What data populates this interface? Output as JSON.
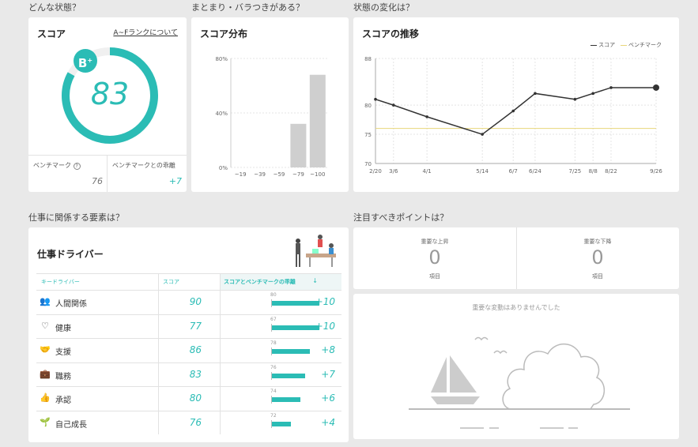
{
  "sections": {
    "state": "どんな状態？",
    "spread": "まとまり・バラつきがある？",
    "trend": "状態の変化は？",
    "factors": "仕事に関係する要素は？",
    "points": "注目すべきポイントは？"
  },
  "score_card": {
    "title": "スコア",
    "rank_link": "A~Fランクについて",
    "grade": "B",
    "grade_sup": "+",
    "score": "83",
    "score_fraction": 0.83,
    "benchmark_label": "ベンチマーク",
    "benchmark_help": "?",
    "benchmark_value": "76",
    "gap_label": "ベンチマークとの乖離",
    "gap_value": "+7",
    "color": "#2bbcb5"
  },
  "distribution": {
    "title": "スコア分布",
    "chart_data": {
      "type": "bar",
      "categories": [
        "~19",
        "~39",
        "~59",
        "~79",
        "~100"
      ],
      "values": [
        0,
        0,
        0,
        32,
        68
      ],
      "yticks": [
        "0%",
        "40%",
        "80%"
      ],
      "ylim": [
        0,
        80
      ]
    }
  },
  "trend": {
    "title": "スコアの推移",
    "legend": {
      "score": "スコア",
      "benchmark": "ベンチマーク"
    },
    "chart_data": {
      "type": "line",
      "x": [
        "2/20",
        "3/6",
        "4/1",
        "5/14",
        "6/7",
        "6/24",
        "7/25",
        "8/8",
        "8/22",
        "9/26"
      ],
      "x_pos": [
        0,
        14,
        40,
        83,
        107,
        124,
        155,
        169,
        183,
        218
      ],
      "series": [
        {
          "name": "スコア",
          "values": [
            81,
            80,
            78,
            75,
            79,
            82,
            81,
            82,
            83,
            83
          ]
        },
        {
          "name": "ベンチマーク",
          "values": [
            76,
            76,
            76,
            76,
            76,
            76,
            76,
            76,
            76,
            76
          ]
        }
      ],
      "yticks": [
        70,
        75,
        80,
        88
      ],
      "ylim": [
        70,
        88
      ],
      "colors": {
        "score": "#333333",
        "benchmark": "#e8d67a"
      }
    }
  },
  "drivers": {
    "title": "仕事ドライバー",
    "col_driver": "キードライバー",
    "col_score": "スコア",
    "col_gap": "スコアとベンチマークの乖離",
    "sort_icon": "↓",
    "rows": [
      {
        "icon": "people-icon",
        "glyph": "👥",
        "name": "人間関係",
        "score": "90",
        "bench": "80",
        "bench_val": 80,
        "gap": "+10",
        "gap_val": 10
      },
      {
        "icon": "heart-icon",
        "glyph": "♡",
        "name": "健康",
        "score": "77",
        "bench": "67",
        "bench_val": 67,
        "gap": "+10",
        "gap_val": 10
      },
      {
        "icon": "handshake-icon",
        "glyph": "🤝",
        "name": "支援",
        "score": "86",
        "bench": "78",
        "bench_val": 78,
        "gap": "+8",
        "gap_val": 8
      },
      {
        "icon": "briefcase-icon",
        "glyph": "💼",
        "name": "職務",
        "score": "83",
        "bench": "76",
        "bench_val": 76,
        "gap": "+7",
        "gap_val": 7
      },
      {
        "icon": "thumbs-up-icon",
        "glyph": "👍",
        "name": "承認",
        "score": "80",
        "bench": "74",
        "bench_val": 74,
        "gap": "+6",
        "gap_val": 6
      },
      {
        "icon": "sprout-icon",
        "glyph": "🌱",
        "name": "自己成長",
        "score": "76",
        "bench": "72",
        "bench_val": 72,
        "gap": "+4",
        "gap_val": 4
      }
    ]
  },
  "points": {
    "rise_label": "重要な上昇",
    "rise_value": "0",
    "rise_unit": "項目",
    "fall_label": "重要な下降",
    "fall_value": "0",
    "fall_unit": "項目",
    "empty_message": "重要な変動はありませんでした"
  }
}
